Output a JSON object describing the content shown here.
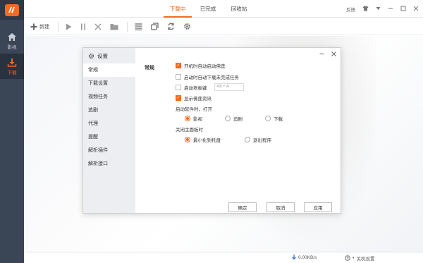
{
  "sidebar": {
    "items": [
      {
        "label": "影视",
        "icon": "home-icon"
      },
      {
        "label": "下载",
        "icon": "download-icon"
      }
    ]
  },
  "topbar": {
    "tabs": [
      {
        "label": "下载中"
      },
      {
        "label": "已完成"
      },
      {
        "label": "回收站"
      }
    ],
    "feedback_label": "反馈"
  },
  "toolbar": {
    "new_label": "新建"
  },
  "dialog": {
    "title": "设置",
    "side_items": [
      "常规",
      "下载设置",
      "视频任务",
      "追剧",
      "代理",
      "提醒",
      "解析插件",
      "解析接口"
    ],
    "section_title": "常规",
    "checkboxes": [
      {
        "label": "开机时自动启动佛莲",
        "checked": true
      },
      {
        "label": "启动时自动下载未完成任务",
        "checked": false
      },
      {
        "label": "启动老板键",
        "checked": false
      },
      {
        "label": "显示佛莲资讯",
        "checked": true
      }
    ],
    "hotkey_value": "Alt + A",
    "startup_group": {
      "label": "启动软件时，打开",
      "options": [
        "影视",
        "追剧",
        "下载"
      ],
      "selected": "影视"
    },
    "close_group": {
      "label": "关闭主面板时",
      "options": [
        "最小化到托盘",
        "退出程序"
      ],
      "selected": "最小化到托盘"
    },
    "buttons": {
      "ok": "确定",
      "cancel": "取消",
      "apply": "应用"
    }
  },
  "status": {
    "speed": "0.00KB/s",
    "shutdown_label": "关机设置"
  },
  "colors": {
    "accent": "#f26b22",
    "sidebar_bg": "#3a4556"
  }
}
